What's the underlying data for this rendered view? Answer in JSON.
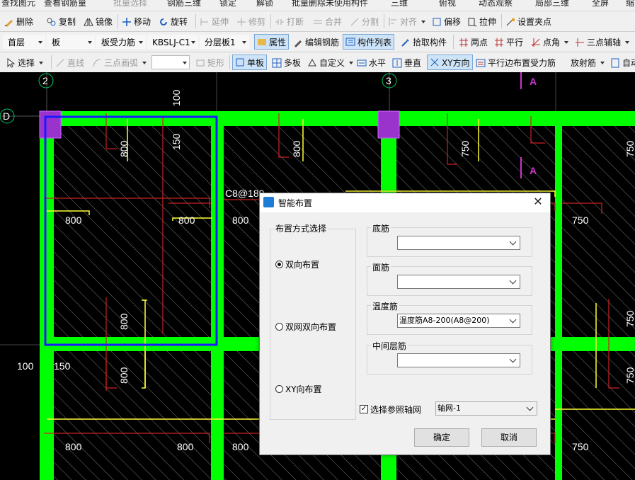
{
  "toolbar_top": {
    "items": [
      "查找图元",
      "查看钢筋量",
      "批量选择",
      "钢筋三维",
      "锁定",
      "解锁",
      "批量删除未使用构件",
      "三维",
      "俯视",
      "动态观察",
      "局部三维",
      "全屏",
      "缩"
    ]
  },
  "toolbar_edit": {
    "delete": "删除",
    "copy": "复制",
    "mirror": "镜像",
    "move": "移动",
    "rotate": "旋转",
    "extend": "延伸",
    "trim": "修剪",
    "break": "打断",
    "merge": "合并",
    "split": "分割",
    "align": "对齐",
    "offset": "偏移",
    "stretch": "拉伸",
    "set_point": "设置夹点"
  },
  "toolbar_props": {
    "floor": "首层",
    "category": "板",
    "type": "板受力筋",
    "component": "KBSLJ-C1",
    "layer": "分层板1",
    "properties": "属性",
    "edit_rebar": "编辑钢筋",
    "component_list": "构件列表",
    "pick": "拾取构件",
    "two_points": "两点",
    "parallel": "平行",
    "point_angle": "点角",
    "three_point_axis": "三点辅轴"
  },
  "toolbar_draw": {
    "select": "选择",
    "line": "直线",
    "arc": "三点画弧",
    "rect": "矩形",
    "single_board": "单板",
    "multi_board": "多板",
    "custom": "自定义",
    "horizontal": "水平",
    "vertical": "垂直",
    "xy_direction": "XY方向",
    "parallel_edge": "平行边布置受力筋",
    "radial": "放射筋",
    "auto": "自动"
  },
  "canvas": {
    "axis_labels": [
      "2",
      "3",
      "D"
    ],
    "labels": [
      "100",
      "150",
      "800",
      "800",
      "800",
      "800",
      "800",
      "800",
      "800",
      "800",
      "750",
      "750",
      "750",
      "750",
      "750",
      "750",
      "C8@180",
      "A",
      "A",
      "100",
      "150",
      "800",
      "800",
      "800",
      "800"
    ]
  },
  "dialog": {
    "title": "智能布置",
    "close": "✕",
    "layout_group": "布置方式选择",
    "options": [
      "双向布置",
      "双网双向布置",
      "XY向布置"
    ],
    "selected_option": "双向布置",
    "bottom_label": "底筋",
    "bottom_value": "",
    "top_label": "面筋",
    "top_value": "",
    "temp_label": "温度筋",
    "temp_value": "温度筋A8-200(A8@200)",
    "middle_label": "中间层筋",
    "middle_value": "",
    "ref_axis_label": "选择参照轴网",
    "ref_axis_checked": true,
    "ref_axis_value": "轴网-1",
    "ok": "确定",
    "cancel": "取消"
  },
  "colors": {
    "canvas_bg": "#000000",
    "slab_edge": "#00ff00",
    "selection": "#1a1aff",
    "column": "#9933cc",
    "rebar_red": "#cc2222",
    "rebar_yellow": "#ffff33"
  }
}
